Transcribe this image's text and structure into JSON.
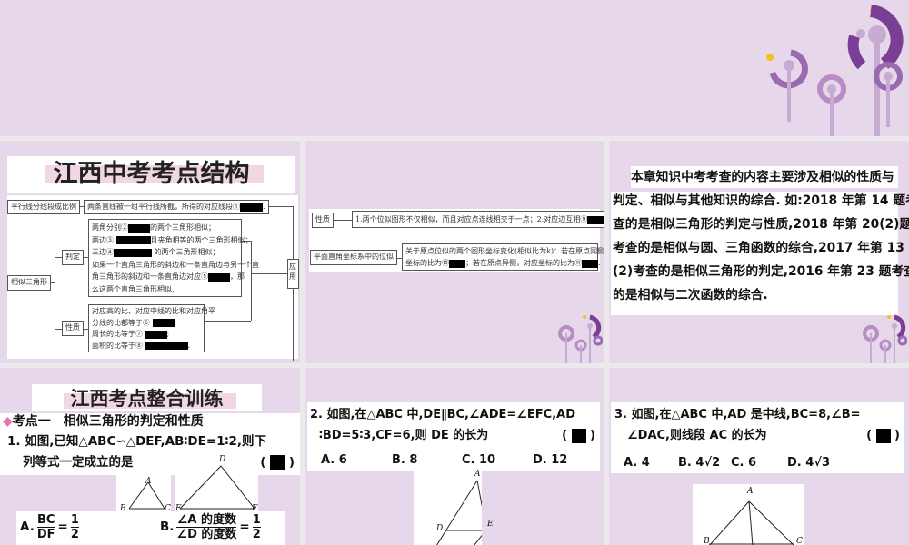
{
  "colors": {
    "slide_bg": "#e6d7ea",
    "accent_purple": "#7a3f94",
    "accent_yellow": "#f2c21b",
    "highlight_pink": "#f1d7e4"
  },
  "slide1": {
    "title": "江西中考考点结构",
    "parallel_label": "平行线分线段成比例",
    "parallel_text": "两条直线被一组平行线所截，所得的对应线段①",
    "similar_label": "相似三角形",
    "judge_label": "判定",
    "judge_lines": [
      "两角分别②",
      "的两个三角形相似；",
      "两边③",
      "且夹角相等的两个三角形相似；",
      "三边④",
      "的两个三角形相似；",
      "如果一个直角三角形的斜边和一条直角边与另一个直",
      "角三角形的斜边和一条直角边对应⑤",
      "，那",
      "么这两个直角三角形相似."
    ],
    "prop_label": "性质",
    "prop_lines": [
      "对应高的比、对应中线的比和对应角平",
      "分线的比都等于⑥",
      "周长的比等于⑦",
      "面积的比等于⑧"
    ],
    "apply_label": "应用"
  },
  "slide2": {
    "prop_label": "性质",
    "prop_text": "1.两个位似图形不仅相似，而且对应点连线相交于一点；2.对应边互相⑨",
    "coord_label": "平面直角坐标系中的位似",
    "coord_line1": "关于原点位似的两个图形坐标变化(相似比为k)：若在原点同侧，对应",
    "coord_line2a": "坐标的比为⑩",
    "coord_line2b": "；若在原点异侧，对应坐标的比为⑪"
  },
  "slide3": {
    "lines": [
      "本章知识中考考查的内容主要涉及相似的性质与",
      "判定、相似与其他知识的综合. 如:2018 年第 14 题考",
      "查的是相似三角形的判定与性质,2018 年第 20(2)题",
      "考查的是相似与圆、三角函数的综合,2017 年第 13 题",
      "(2)考查的是相似三角形的判定,2016 年第 23 题考查",
      "的是相似与二次函数的综合."
    ]
  },
  "slide4": {
    "title": "江西考点整合训练",
    "section": "考点一　相似三角形的判定和性质",
    "q_line1": "1. 如图,已知△ABC∽△DEF,AB∶DE=1∶2,则下",
    "q_line2": "列等式一定成立的是",
    "paren_open": "(",
    "paren_close": ")",
    "labels": {
      "A": "A",
      "B": "B",
      "C": "C",
      "D": "D",
      "E": "E",
      "F": "F"
    },
    "optA_label": "A.",
    "optA_num": "BC",
    "optA_den": "DF",
    "optA_val_num": "1",
    "optA_val_den": "2",
    "optB_label": "B.",
    "optB_num": "∠A 的度数",
    "optB_den": "∠D 的度数",
    "optB_val_num": "1",
    "optB_val_den": "2",
    "eq": "="
  },
  "slide5": {
    "q_line1": "2. 如图,在△ABC 中,DE∥BC,∠ADE=∠EFC,AD",
    "q_line2": "∶BD=5∶3,CF=6,则 DE 的长为",
    "options": [
      "A. 6",
      "B. 8",
      "C. 10",
      "D. 12"
    ],
    "labels": {
      "A": "A",
      "D": "D",
      "E": "E"
    }
  },
  "slide6": {
    "q_line1": "3. 如图,在△ABC 中,AD 是中线,BC=8,∠B=",
    "q_line2": "∠DAC,则线段 AC 的长为",
    "options": [
      "A. 4",
      "B. 4√2",
      "C. 6",
      "D. 4√3"
    ],
    "labels": {
      "A": "A",
      "B": "B",
      "C": "C"
    }
  }
}
